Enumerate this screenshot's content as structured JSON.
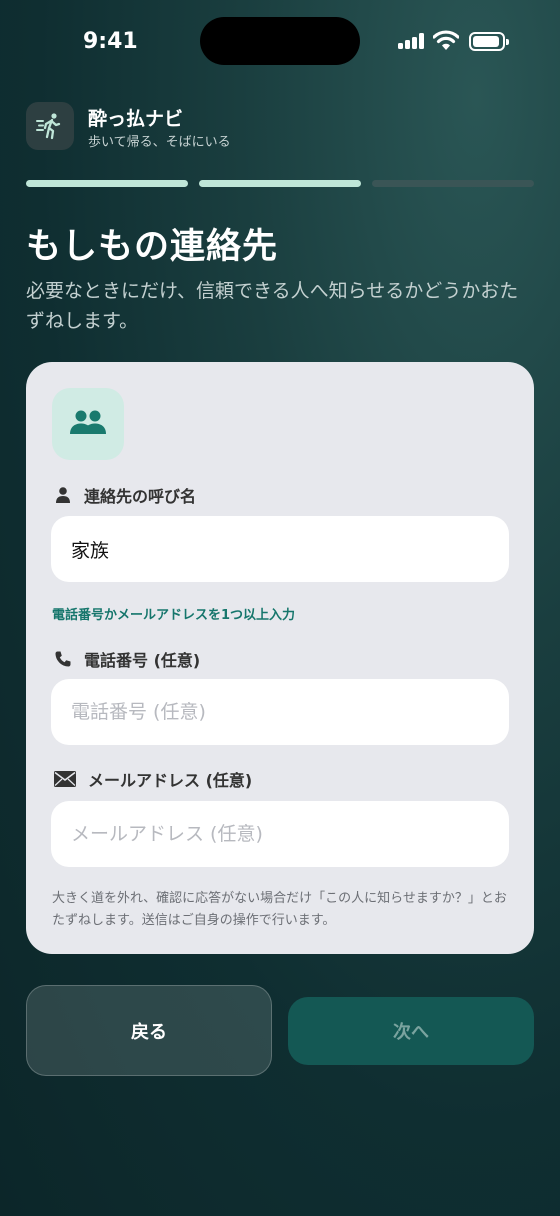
{
  "status_bar": {
    "time": "9:41"
  },
  "app": {
    "name": "酔っ払ナビ",
    "tagline": "歩いて帰る、そばにいる"
  },
  "progress": {
    "total_steps": 3,
    "completed_steps": 2,
    "active_color": "#bfe6d8",
    "inactive_color": "#3a5556"
  },
  "page": {
    "title": "もしもの連絡先",
    "subtitle": "必要なときにだけ、信頼できる人へ知らせるかどうかおたずねします。"
  },
  "form": {
    "name_label": "連絡先の呼び名",
    "name_value": "家族",
    "hint": "電話番号かメールアドレスを1つ以上入力",
    "phone_label": "電話番号 (任意)",
    "phone_placeholder": "電話番号 (任意)",
    "phone_value": "",
    "email_label": "メールアドレス (任意)",
    "email_placeholder": "メールアドレス (任意)",
    "email_value": "",
    "note": "大きく道を外れ、確認に応答がない場合だけ「この人に知らせますか？」とおたずねします。送信はご自身の操作で行います。"
  },
  "buttons": {
    "back": "戻る",
    "next": "次へ"
  },
  "colors": {
    "accent": "#1a7a6e",
    "next_button_bg": "#145854",
    "hint_text": "#16766c"
  },
  "icons": {
    "app": "walking-person-icon",
    "contact": "people-icon",
    "name": "person-icon",
    "phone": "phone-icon",
    "email": "envelope-icon"
  }
}
